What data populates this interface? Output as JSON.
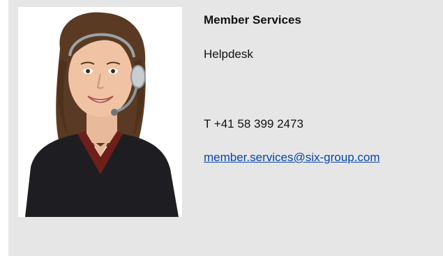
{
  "contact": {
    "name": "Member Services",
    "department": "Helpdesk",
    "phone": "T +41 58 399 2473",
    "email": "member.services@six-group.com"
  },
  "colors": {
    "card_background": "#e6e6e6",
    "link": "#0645ad"
  },
  "icons": {
    "photo": "support-agent-photo"
  }
}
